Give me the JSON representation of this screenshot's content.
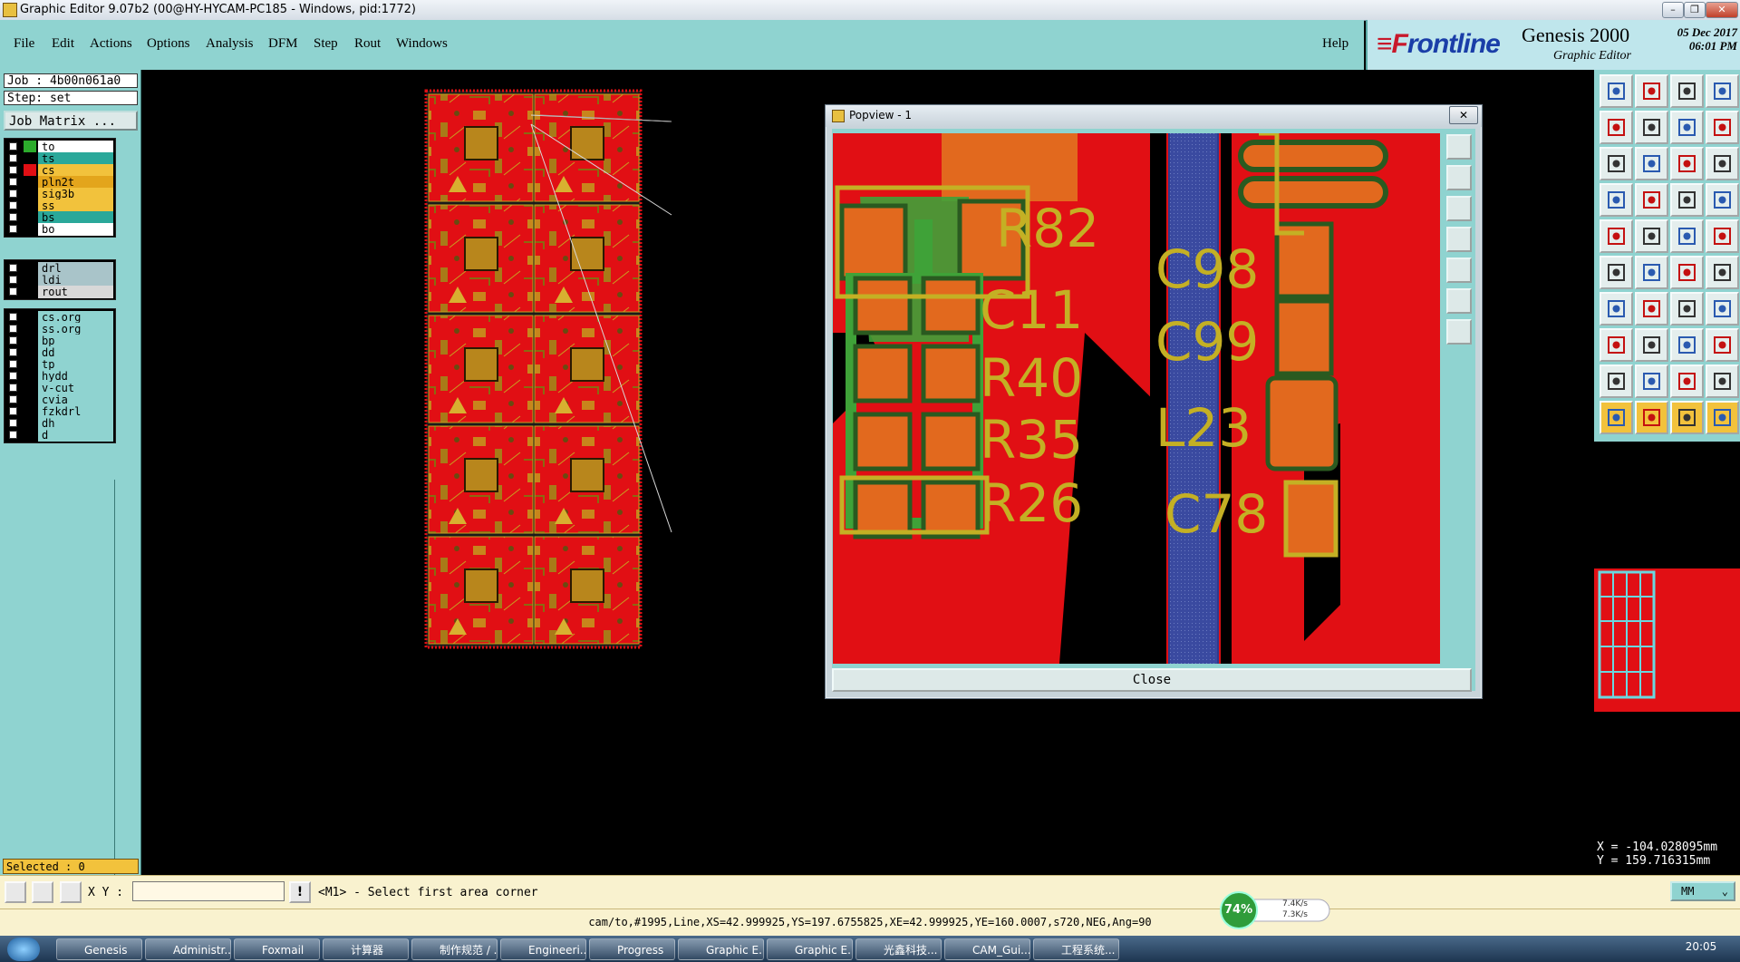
{
  "window": {
    "title": "Graphic Editor 9.07b2 (00@HY-HYCAM-PC185 - Windows, pid:1772)",
    "min_label": "–",
    "max_label": "❐",
    "close_label": "✕"
  },
  "menu": {
    "items": [
      "File",
      "Edit",
      "Actions",
      "Options",
      "Analysis",
      "DFM",
      "Step",
      "Rout",
      "Windows"
    ],
    "help": "Help"
  },
  "brand": {
    "logo_prefix": "≡F",
    "logo_rest": "rontline",
    "product": "Genesis 2000",
    "subtitle": "Graphic Editor",
    "date": "05 Dec 2017",
    "time": "06:01 PM"
  },
  "left": {
    "job": "Job : 4b00n061a0",
    "step": "Step: set",
    "job_matrix": "Job Matrix ...",
    "layers_group1": [
      {
        "name": "to",
        "color": "#ffffff",
        "swatch": "#2cab2c"
      },
      {
        "name": "ts",
        "color": "#2aa89a",
        "swatch": "#000000"
      },
      {
        "name": "cs",
        "color": "#f2c23c",
        "swatch": "#e10f14"
      },
      {
        "name": "pln2t",
        "color": "#e3a51c",
        "swatch": "#000000"
      },
      {
        "name": "sig3b",
        "color": "#f2c23c",
        "swatch": "#000000"
      },
      {
        "name": "ss",
        "color": "#f2c23c",
        "swatch": "#000000"
      },
      {
        "name": "bs",
        "color": "#2aa89a",
        "swatch": "#000000"
      },
      {
        "name": "bo",
        "color": "#ffffff",
        "swatch": "#000000"
      }
    ],
    "layers_group2": [
      {
        "name": "drl",
        "color": "#a9c4c9",
        "swatch": "#000000"
      },
      {
        "name": "ldi",
        "color": "#a9c4c9",
        "swatch": "#000000"
      },
      {
        "name": "rout",
        "color": "#d8d8d8",
        "swatch": "#000000"
      }
    ],
    "layers_group3": [
      {
        "name": "cs.org",
        "color": "#8fd3d0",
        "swatch": "#000000"
      },
      {
        "name": "ss.org",
        "color": "#8fd3d0",
        "swatch": "#000000"
      },
      {
        "name": "bp",
        "color": "#8fd3d0",
        "swatch": "#000000"
      },
      {
        "name": "dd",
        "color": "#8fd3d0",
        "swatch": "#000000"
      },
      {
        "name": "tp",
        "color": "#8fd3d0",
        "swatch": "#000000"
      },
      {
        "name": "hydd",
        "color": "#8fd3d0",
        "swatch": "#000000"
      },
      {
        "name": "v-cut",
        "color": "#8fd3d0",
        "swatch": "#000000"
      },
      {
        "name": "cvia",
        "color": "#8fd3d0",
        "swatch": "#000000"
      },
      {
        "name": "fzkdrl",
        "color": "#8fd3d0",
        "swatch": "#000000"
      },
      {
        "name": "dh",
        "color": "#8fd3d0",
        "swatch": "#000000"
      },
      {
        "name": "d",
        "color": "#8fd3d0",
        "swatch": "#000000"
      }
    ],
    "selected": "Selected : 0"
  },
  "popview": {
    "title": "Popview - 1",
    "close_button": "Close",
    "x_label": "✕",
    "refdes": [
      "R82",
      "C11",
      "R40",
      "R35",
      "R26",
      "C98",
      "C99",
      "L23",
      "C78"
    ]
  },
  "coords": {
    "x": "X = -104.028095mm",
    "y": "Y =  159.716315mm"
  },
  "command": {
    "xy_label": "X Y :",
    "xy_value": "",
    "warn": "!",
    "prompt": "<M1> - Select first area corner",
    "units": "MM"
  },
  "status": "cam/to,#1995,Line,XS=42.999925,YS=197.6755825,XE=42.999925,YE=160.0007,s720,NEG,Ang=90",
  "network": {
    "percent": "74%",
    "up": "7.4K/s",
    "down": "7.3K/s"
  },
  "taskbar": {
    "items": [
      "Genesis",
      "Administr...",
      "Foxmail",
      "计算器",
      "制作规范 / ...",
      "Engineeri...",
      "Progress",
      "Graphic E...",
      "Graphic E...",
      "光鑫科技...",
      "CAM_Gui...",
      "工程系统..."
    ],
    "clock": "20:05"
  },
  "colors": {
    "teal": "#8fd3d0",
    "copper": "#e10f14",
    "pad": "#e2691e",
    "silk": "#c4b024",
    "green": "#3fa238",
    "blue": "#3a4aa0"
  }
}
